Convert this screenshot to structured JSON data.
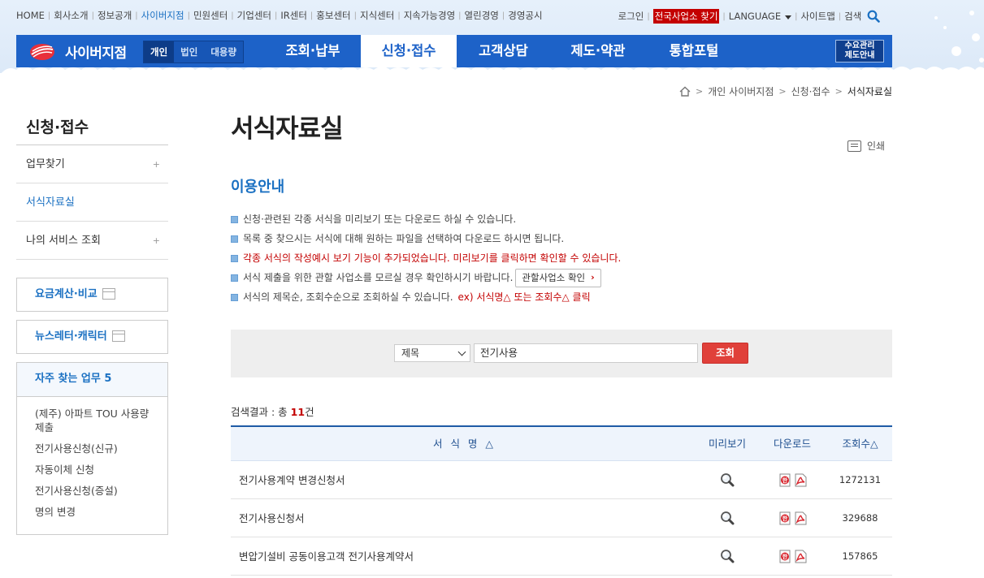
{
  "util_left": {
    "items": [
      "HOME",
      "회사소개",
      "정보공개",
      "사이버지점",
      "민원센터",
      "기업센터",
      "IR센터",
      "홍보센터",
      "지식센터",
      "지속가능경영",
      "열린경영",
      "경영공시"
    ],
    "active_index": 3
  },
  "util_right": {
    "login": "로그인",
    "office_finder": "전국사업소 찾기",
    "language": "LANGUAGE",
    "sitemap": "사이트맵",
    "search": "검색"
  },
  "gnb": {
    "brand": "사이버지점",
    "segments": [
      "개인",
      "법인",
      "대용량"
    ],
    "active_segment": 0,
    "menu": [
      "조회·납부",
      "신청·접수",
      "고객상담",
      "제도·약관",
      "통합포털"
    ],
    "active_menu": 1,
    "side_button_line1": "수요관리",
    "side_button_line2": "제도안내"
  },
  "breadcrumb": [
    "개인 사이버지점",
    "신청·접수",
    "서식자료실"
  ],
  "sidebar": {
    "title": "신청·접수",
    "items": [
      {
        "label": "업무찾기",
        "plus": "+"
      },
      {
        "label": "서식자료실",
        "plus": ""
      },
      {
        "label": "나의 서비스 조회",
        "plus": "+"
      }
    ],
    "box1": "요금계산·비교",
    "box2": "뉴스레터·캐릭터",
    "faq_title": "자주 찾는 업무 5",
    "faq_items": [
      "(제주) 아파트 TOU 사용량 제출",
      "전기사용신청(신규)",
      "자동이체 신청",
      "전기사용신청(증설)",
      "명의 변경"
    ]
  },
  "content": {
    "title": "서식자료실",
    "print": "인쇄",
    "section_title": "이용안내",
    "guide": [
      "신청·관련된 각종 서식을 미리보기 또는 다운로드 하실 수 있습니다.",
      "목록 중 찾으시는 서식에 대해 원하는 파일을 선택하여 다운로드 하시면 됩니다.",
      "각종 서식의 작성예시 보기 기능이 추가되었습니다. 미리보기를 클릭하면 확인할 수 있습니다.",
      "서식 제출을 위한 관할 사업소를 모르실 경우 확인하시기 바랍니다.",
      "서식의 제목순, 조회수순으로 조회하실 수 있습니다."
    ],
    "guide_office_button": "관할사업소 확인",
    "guide_example": "ex) 서식명△ 또는 조회수△ 클릭"
  },
  "search": {
    "select_value": "제목",
    "input_value": "전기사용",
    "button": "조회"
  },
  "result": {
    "prefix": "검색결과 : 총",
    "count": "11",
    "suffix": "건"
  },
  "table": {
    "headers": [
      "서 식 명 △",
      "미리보기",
      "다운로드",
      "조회수△"
    ],
    "rows": [
      {
        "title": "전기사용계약 변경신청서",
        "views": "1272131"
      },
      {
        "title": "전기사용신청서",
        "views": "329688"
      },
      {
        "title": "변압기설비 공동이용고객 전기사용계약서",
        "views": "157865"
      }
    ]
  },
  "colors": {
    "brand_blue": "#1d62c8",
    "accent_red": "#c30000",
    "link_blue": "#1a70c2"
  }
}
